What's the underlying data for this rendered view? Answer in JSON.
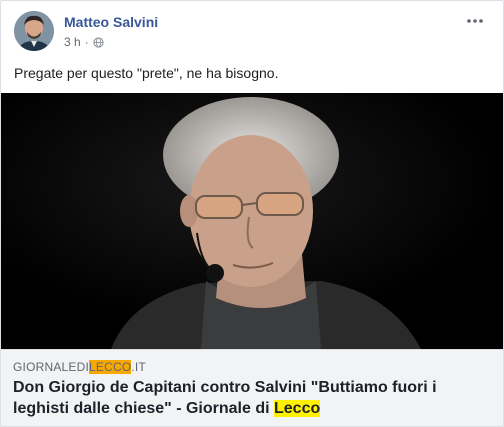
{
  "post": {
    "author": "Matteo Salvini",
    "time": "3 h",
    "separator": "·",
    "privacy_icon": "globe-icon",
    "menu_icon": "more-options-icon",
    "message": "Pregate per questo \"prete\", ne ha bisogno."
  },
  "link": {
    "domain_prefix": "GIORNALEDI",
    "domain_highlight": "LECCO",
    "domain_suffix": ".IT",
    "title_main": "Don Giorgio de Capitani contro Salvini \"Buttiamo fuori i leghisti dalle chiese\" - Giornale di ",
    "title_highlight": "Lecco"
  },
  "colors": {
    "author": "#385898",
    "highlight_orange": "#f7a800",
    "highlight_yellow": "#fff200"
  }
}
